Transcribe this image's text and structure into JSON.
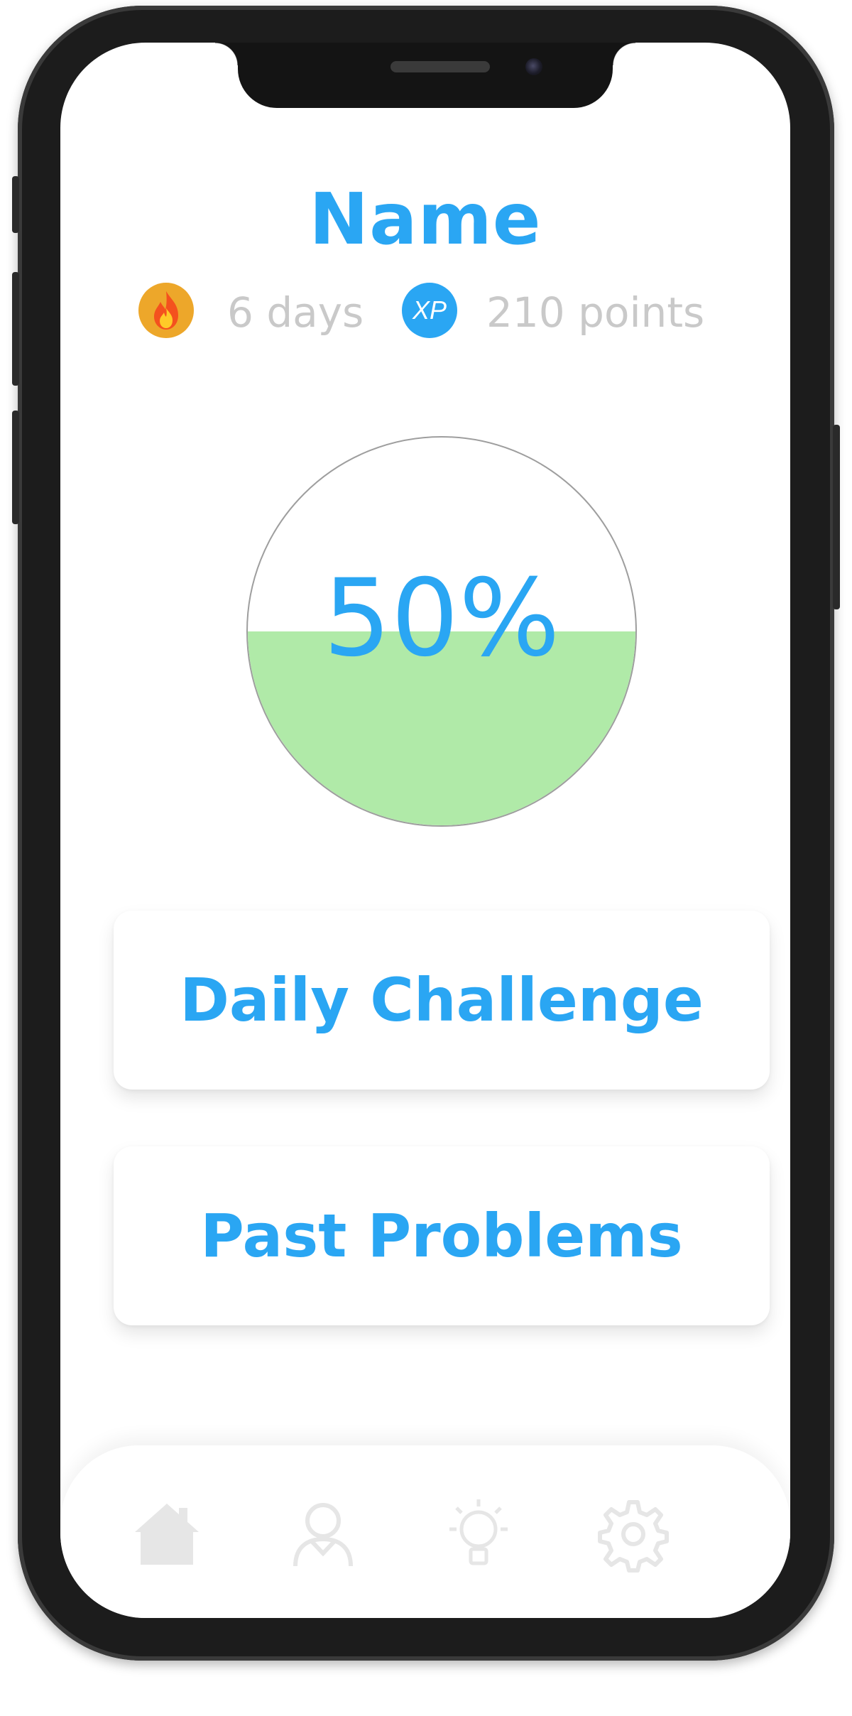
{
  "profile": {
    "name": "Name"
  },
  "stats": {
    "streak_label": "6 days",
    "streak_icon": "fire-icon",
    "xp_badge": "XP",
    "points_label": "210 points",
    "streak_icon_color": "#eda72a",
    "xp_icon_color": "#2aa6f3"
  },
  "progress": {
    "label": "50%",
    "value": 0.5,
    "fill_color": "#b0eaa8"
  },
  "actions": {
    "daily_challenge": "Daily Challenge",
    "past_problems": "Past Problems"
  },
  "nav": {
    "items": [
      {
        "icon": "home-icon",
        "active": true
      },
      {
        "icon": "profile-icon",
        "active": false
      },
      {
        "icon": "lightbulb-icon",
        "active": false
      },
      {
        "icon": "gear-icon",
        "active": false
      }
    ]
  },
  "colors": {
    "accent": "#2aa6f3",
    "muted_text": "#c9c9c9",
    "nav_icon": "#e6e6e6"
  }
}
